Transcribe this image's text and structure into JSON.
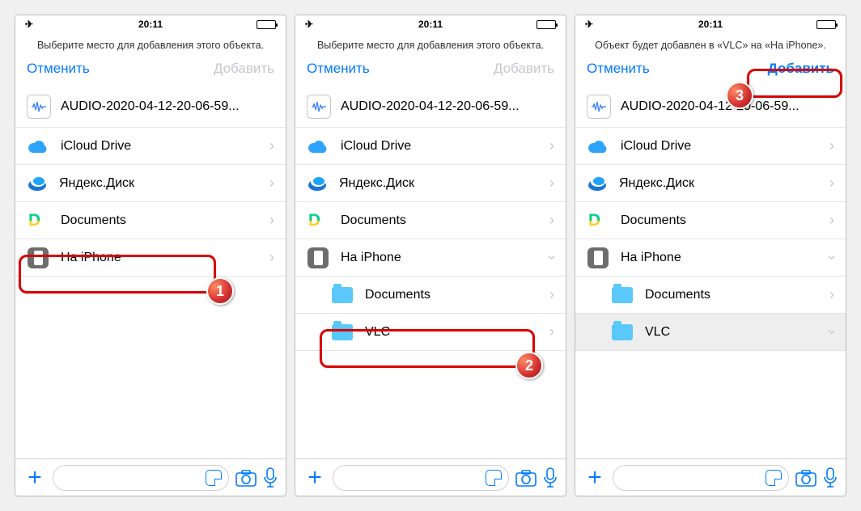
{
  "common": {
    "time": "20:11",
    "file_name": "AUDIO-2020-04-12-20-06-59...",
    "cancel": "Отменить",
    "add": "Добавить",
    "locations": {
      "icloud": "iCloud Drive",
      "yandex": "Яндекс.Диск",
      "documents": "Documents",
      "on_iphone": "На iPhone",
      "sub_documents": "Documents",
      "sub_vlc": "VLC"
    }
  },
  "screens": [
    {
      "prompt": "Выберите место для добавления этого объекта.",
      "add_enabled": false,
      "badge": "1"
    },
    {
      "prompt": "Выберите место для добавления этого объекта.",
      "add_enabled": false,
      "badge": "2"
    },
    {
      "prompt": "Объект будет добавлен в «VLC» на «На iPhone».",
      "add_enabled": true,
      "badge": "3"
    }
  ]
}
